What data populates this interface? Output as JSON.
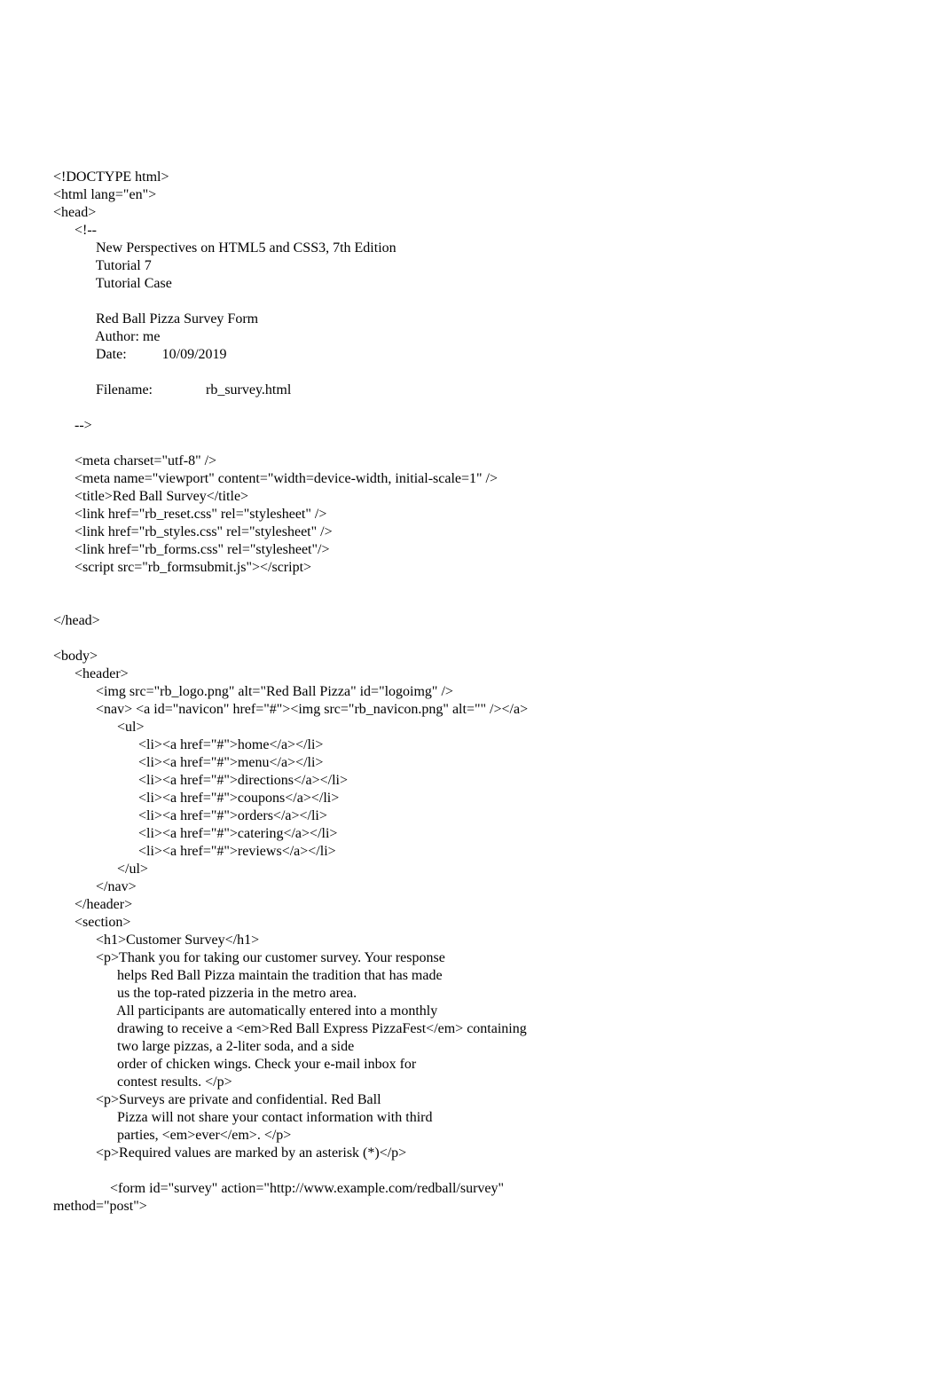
{
  "lines": [
    "<!DOCTYPE html>",
    "<html lang=\"en\">",
    "<head>",
    "      <!--",
    "            New Perspectives on HTML5 and CSS3, 7th Edition",
    "            Tutorial 7",
    "            Tutorial Case",
    "",
    "            Red Ball Pizza Survey Form",
    "            Author: me",
    "            Date:          10/09/2019",
    "",
    "            Filename:               rb_survey.html",
    "",
    "      -->",
    "",
    "      <meta charset=\"utf-8\" />",
    "      <meta name=\"viewport\" content=\"width=device-width, initial-scale=1\" />",
    "      <title>Red Ball Survey</title>",
    "      <link href=\"rb_reset.css\" rel=\"stylesheet\" />",
    "      <link href=\"rb_styles.css\" rel=\"stylesheet\" />",
    "      <link href=\"rb_forms.css\" rel=\"stylesheet\"/>",
    "      <script src=\"rb_formsubmit.js\"></script>",
    "",
    "",
    "</head>",
    "",
    "<body>",
    "      <header>",
    "            <img src=\"rb_logo.png\" alt=\"Red Ball Pizza\" id=\"logoimg\" />",
    "            <nav> <a id=\"navicon\" href=\"#\"><img src=\"rb_navicon.png\" alt=\"\" /></a>",
    "                  <ul>",
    "                        <li><a href=\"#\">home</a></li>",
    "                        <li><a href=\"#\">menu</a></li>",
    "                        <li><a href=\"#\">directions</a></li>",
    "                        <li><a href=\"#\">coupons</a></li>",
    "                        <li><a href=\"#\">orders</a></li>",
    "                        <li><a href=\"#\">catering</a></li>",
    "                        <li><a href=\"#\">reviews</a></li>",
    "                  </ul>",
    "            </nav>",
    "      </header>",
    "      <section>",
    "            <h1>Customer Survey</h1>",
    "            <p>Thank you for taking our customer survey. Your response",
    "                  helps Red Ball Pizza maintain the tradition that has made",
    "                  us the top-rated pizzeria in the metro area.",
    "                  All participants are automatically entered into a monthly",
    "                  drawing to receive a <em>Red Ball Express PizzaFest</em> containing",
    "                  two large pizzas, a 2-liter soda, and a side",
    "                  order of chicken wings. Check your e-mail inbox for",
    "                  contest results. </p>",
    "            <p>Surveys are private and confidential. Red Ball",
    "                  Pizza will not share your contact information with third",
    "                  parties, <em>ever</em>. </p>",
    "            <p>Required values are marked by an asterisk (*)</p>",
    "",
    "                <form id=\"survey\" action=\"http://www.example.com/redball/survey\"",
    "method=\"post\">"
  ]
}
